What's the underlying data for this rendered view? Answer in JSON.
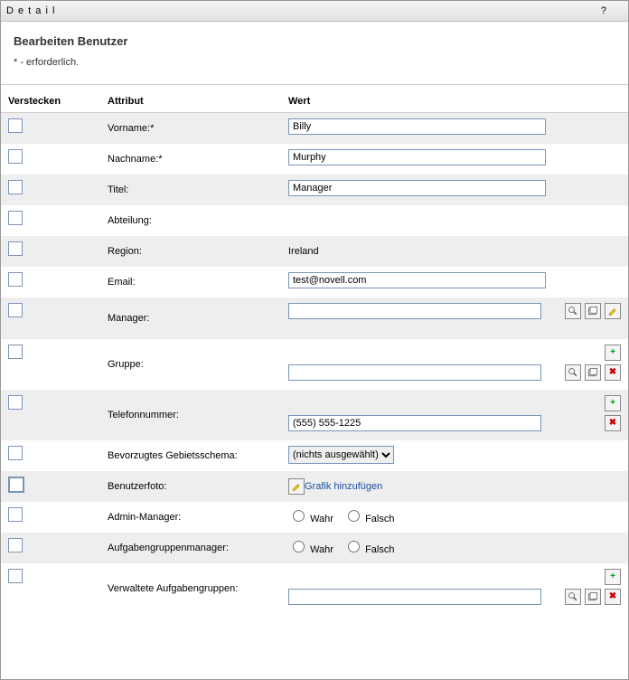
{
  "window": {
    "title": "D e t a i l"
  },
  "page": {
    "heading": "Bearbeiten Benutzer",
    "required_note": "* - erforderlich."
  },
  "columns": {
    "hide": "Verstecken",
    "attribute": "Attribut",
    "value": "Wert"
  },
  "labels": {
    "true": "Wahr",
    "false": "Falsch"
  },
  "rows": {
    "firstname": {
      "label": "Vorname:*",
      "value": "Billy"
    },
    "lastname": {
      "label": "Nachname:*",
      "value": "Murphy"
    },
    "title": {
      "label": "Titel:",
      "value": "Manager"
    },
    "department": {
      "label": "Abteilung:",
      "value": ""
    },
    "region": {
      "label": "Region:",
      "value": "Ireland"
    },
    "email": {
      "label": "Email:",
      "value": "test@novell.com"
    },
    "manager": {
      "label": "Manager:",
      "value": ""
    },
    "group": {
      "label": "Gruppe:",
      "value": ""
    },
    "phone": {
      "label": "Telefonnummer:",
      "value": "(555) 555-1225"
    },
    "locale": {
      "label": "Bevorzugtes Gebietsschema:",
      "value": "(nichts ausgewählt)"
    },
    "photo": {
      "label": "Benutzerfoto:",
      "link": "Grafik hinzufügen"
    },
    "adminmgr": {
      "label": "Admin-Manager:"
    },
    "taskmgr": {
      "label": "Aufgabengruppenmanager:"
    },
    "taskgroups": {
      "label": "Verwaltete Aufgabengruppen:",
      "value": ""
    }
  }
}
